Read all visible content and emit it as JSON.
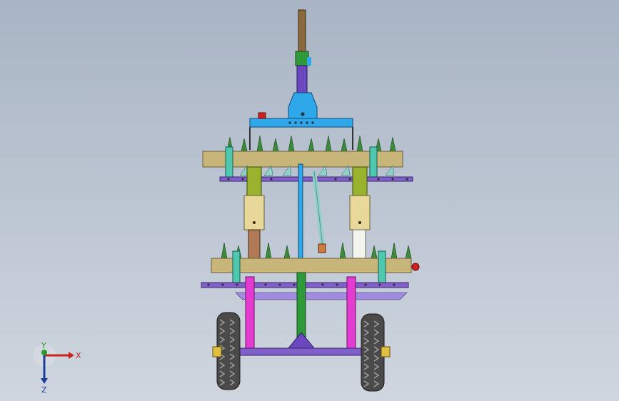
{
  "viewport": {
    "background_top": "#a9b4c4",
    "background_bottom": "#cfd6df"
  },
  "model": {
    "name": "cultivator-assembly",
    "colors": {
      "beam": "#c7b57a",
      "beam_outline": "#6d5f34",
      "post": "#9ab32e",
      "post_lower": "#e8d99a",
      "post_upper": "#b07a57",
      "frame_blue": "#2ea8e8",
      "linkage_purple": "#8060c8",
      "bracket_teal": "#4ec9b0",
      "pink_strut": "#e43bd0",
      "center_green": "#2e9a3a",
      "tine_green": "#3c8a3c",
      "wheel": "#4a4a4a",
      "mast_brown": "#8a6a3c",
      "red_indicator": "#d02020"
    }
  },
  "triad": {
    "x_label": "X",
    "y_label": "Y",
    "z_label": "Z",
    "x_color": "#c8231e",
    "y_color": "#2a9a2a",
    "z_color": "#1e3c9a"
  }
}
